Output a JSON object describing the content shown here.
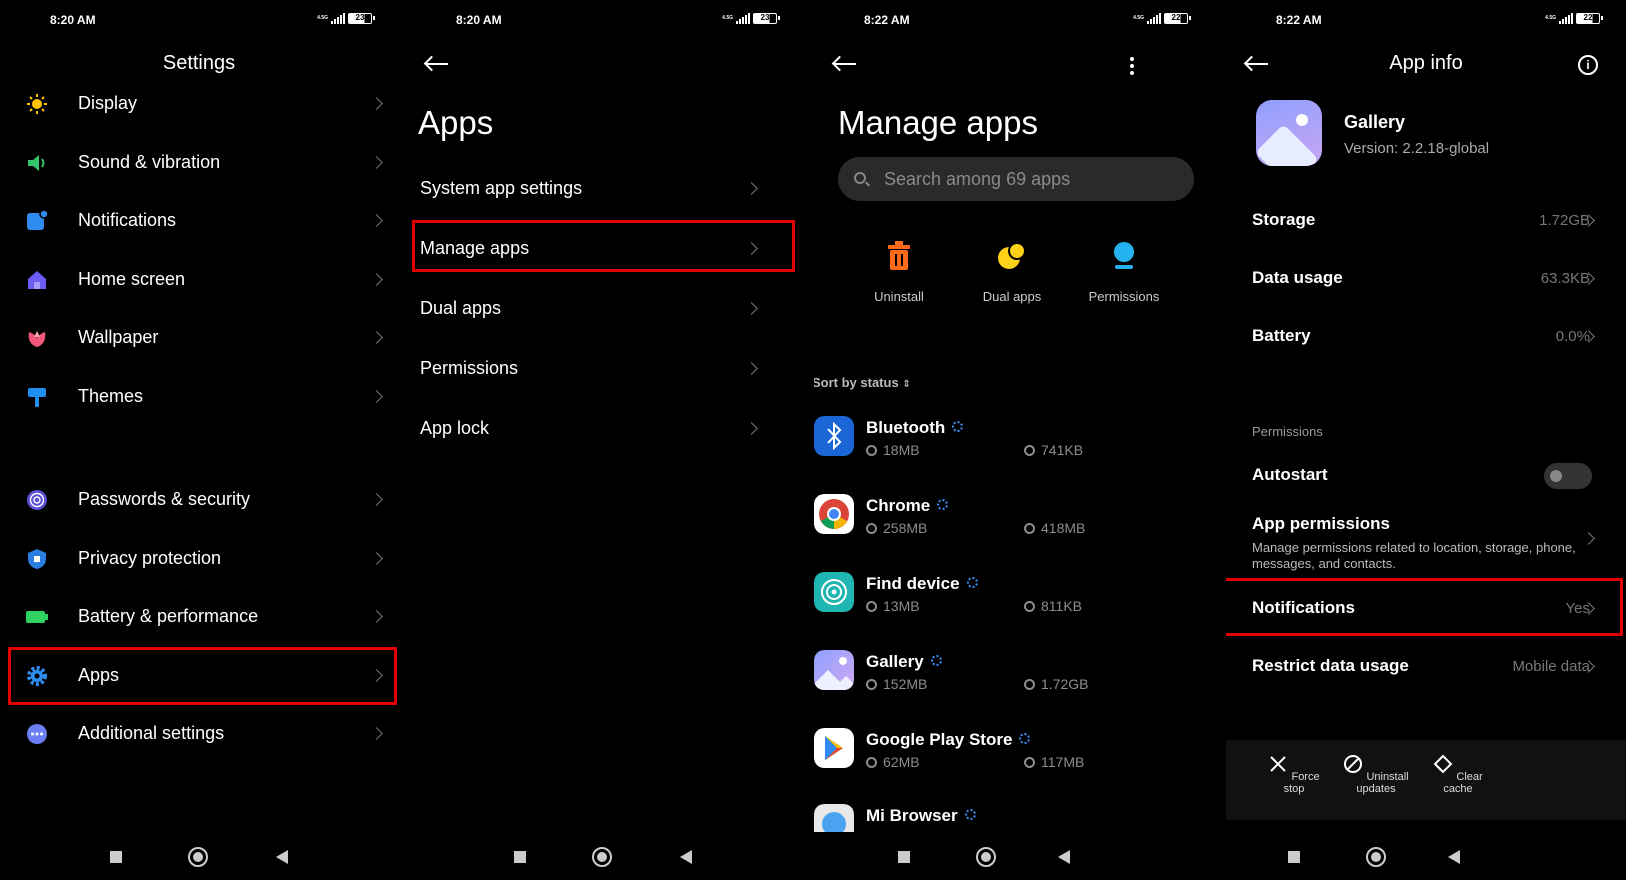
{
  "panel1": {
    "status": {
      "time": "8:20 AM",
      "net": "4.5G",
      "battery": "23"
    },
    "title": "Settings",
    "items": [
      {
        "label": "Display",
        "icon": "sun-icon"
      },
      {
        "label": "Sound & vibration",
        "icon": "speaker-icon"
      },
      {
        "label": "Notifications",
        "icon": "notification-icon"
      },
      {
        "label": "Home screen",
        "icon": "home-icon"
      },
      {
        "label": "Wallpaper",
        "icon": "flower-icon"
      },
      {
        "label": "Themes",
        "icon": "brush-icon"
      },
      {
        "label": "Passwords & security",
        "icon": "fingerprint-icon"
      },
      {
        "label": "Privacy protection",
        "icon": "shield-icon"
      },
      {
        "label": "Battery & performance",
        "icon": "battery-icon"
      },
      {
        "label": "Apps",
        "icon": "gear-icon"
      },
      {
        "label": "Additional settings",
        "icon": "more-icon"
      }
    ]
  },
  "panel2": {
    "status": {
      "time": "8:20 AM",
      "net": "4.5G",
      "battery": "23"
    },
    "title": "Apps",
    "items": [
      {
        "label": "System app settings"
      },
      {
        "label": "Manage apps"
      },
      {
        "label": "Dual apps"
      },
      {
        "label": "Permissions"
      },
      {
        "label": "App lock"
      }
    ]
  },
  "panel3": {
    "status": {
      "time": "8:22 AM",
      "net": "4.5G",
      "battery": "22"
    },
    "title": "Manage apps",
    "search_placeholder": "Search among 69 apps",
    "quick_actions": [
      {
        "label": "Uninstall",
        "icon": "trash-icon"
      },
      {
        "label": "Dual apps",
        "icon": "dual-apps-icon"
      },
      {
        "label": "Permissions",
        "icon": "permissions-icon"
      }
    ],
    "sort_label": "Sort by status",
    "apps": [
      {
        "name": "Bluetooth",
        "app_size": "18MB",
        "cache_size": "741KB",
        "color": "#1a66d6"
      },
      {
        "name": "Chrome",
        "app_size": "258MB",
        "cache_size": "418MB",
        "color": "#ffffff"
      },
      {
        "name": "Find device",
        "app_size": "13MB",
        "cache_size": "811KB",
        "color": "#1fb5b0"
      },
      {
        "name": "Gallery",
        "app_size": "152MB",
        "cache_size": "1.72GB",
        "color": "#9aa6ff"
      },
      {
        "name": "Google Play Store",
        "app_size": "62MB",
        "cache_size": "117MB",
        "color": "#ffffff"
      },
      {
        "name": "Mi Browser",
        "app_size": "",
        "cache_size": "",
        "color": "#ffffff"
      }
    ]
  },
  "panel4": {
    "status": {
      "time": "8:22 AM",
      "net": "4.5G",
      "battery": "22"
    },
    "title": "App info",
    "app_name": "Gallery",
    "version": "Version: 2.2.18-global",
    "rows": [
      {
        "label": "Storage",
        "value": "1.72GB"
      },
      {
        "label": "Data usage",
        "value": "63.3KB"
      },
      {
        "label": "Battery",
        "value": "0.0%"
      }
    ],
    "permissions_section": "Permissions",
    "autostart_label": "Autostart",
    "autostart_on": false,
    "app_permissions_label": "App permissions",
    "app_permissions_desc": "Manage permissions related to location, storage, phone, messages, and contacts.",
    "notifications_label": "Notifications",
    "notifications_value": "Yes",
    "restrict_label": "Restrict data usage",
    "restrict_value": "Mobile data",
    "actions": [
      {
        "label": "Force stop",
        "icon": "close-icon"
      },
      {
        "label": "Uninstall updates",
        "icon": "block-icon"
      },
      {
        "label": "Clear cache",
        "icon": "eraser-icon"
      }
    ]
  },
  "colors": {
    "highlight": "#e30000",
    "accent": "#3a8ff8",
    "background": "#000000"
  }
}
